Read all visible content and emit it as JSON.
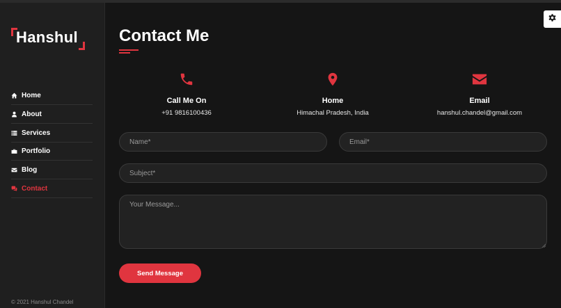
{
  "brand": {
    "name": "Hanshul",
    "accent_color": "#e0353f"
  },
  "nav": {
    "items": [
      {
        "label": "Home",
        "icon": "home-icon",
        "active": false
      },
      {
        "label": "About",
        "icon": "user-icon",
        "active": false
      },
      {
        "label": "Services",
        "icon": "list-icon",
        "active": false
      },
      {
        "label": "Portfolio",
        "icon": "briefcase-icon",
        "active": false
      },
      {
        "label": "Blog",
        "icon": "envelope-icon",
        "active": false
      },
      {
        "label": "Contact",
        "icon": "comments-icon",
        "active": true
      }
    ]
  },
  "footer": {
    "copyright": "© 2021 Hanshul Chandel"
  },
  "page": {
    "title": "Contact Me"
  },
  "contact_info": [
    {
      "icon": "phone-icon",
      "title": "Call Me On",
      "value": "+91 9816100436"
    },
    {
      "icon": "map-marker-icon",
      "title": "Home",
      "value": "Himachal Pradesh, India"
    },
    {
      "icon": "envelope-icon",
      "title": "Email",
      "value": "hanshul.chandel@gmail.com"
    }
  ],
  "form": {
    "name_placeholder": "Name*",
    "email_placeholder": "Email*",
    "subject_placeholder": "Subject*",
    "message_placeholder": "Your Message...",
    "submit_label": "Send Message"
  },
  "settings": {
    "icon": "gear-icon"
  }
}
